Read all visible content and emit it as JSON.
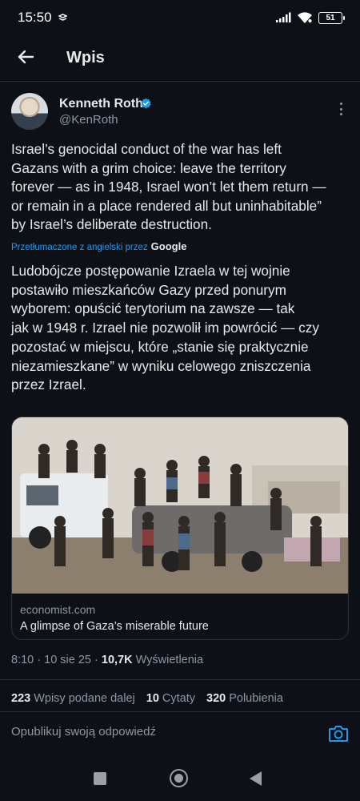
{
  "status_bar": {
    "time": "15:50",
    "battery": "51",
    "icons": [
      "sync-icon",
      "signal-icon",
      "wifi-icon",
      "battery-icon"
    ]
  },
  "header": {
    "title": "Wpis",
    "back_icon": "arrow-left-icon"
  },
  "post": {
    "author_name": "Kenneth Roth",
    "author_handle": "@KenRoth",
    "verified": true,
    "text": "Israel’s genocidal conduct of the war has left\nGazans with a grim choice: leave the territory\nforever — as in 1948, Israel won’t let them return —\nor remain in a place rendered all but uninhabitable”\nby Israel’s deliberate destruction.",
    "translated_label": "Przetłumaczone z angielski przez",
    "translated_provider": "Google",
    "translation": "Ludobójcze postępowanie Izraela w tej wojnie\npostawiło mieszkańców Gazy przed ponurym\nwyborem: opuścić terytorium na zawsze — tak\njak w 1948 r. Izrael nie pozwolił im powrócić — czy\npozostać w miejscu, które „stanie się praktycznie\nniezamieszkane” w wyniku celowego zniszczenia\nprzez Izrael.",
    "card": {
      "domain": "economist.com",
      "title": "A glimpse of Gaza’s miserable future"
    },
    "meta": {
      "time": "8:10",
      "date": "10 sie 25",
      "views_count": "10,7K",
      "views_label": "Wyświetlenia"
    },
    "stats": {
      "reposts_count": "223",
      "reposts_label": "Wpisy podane dalej",
      "quotes_count": "10",
      "quotes_label": "Cytaty",
      "likes_count": "320",
      "likes_label": "Polubienia"
    }
  },
  "reply": {
    "placeholder": "Opublikuj swoją odpowiedź",
    "camera_icon": "camera-icon"
  },
  "colors": {
    "background": "#0d1016",
    "accent": "#1d9bf0",
    "text": "#e7e9ea",
    "muted": "#8b98a5"
  }
}
